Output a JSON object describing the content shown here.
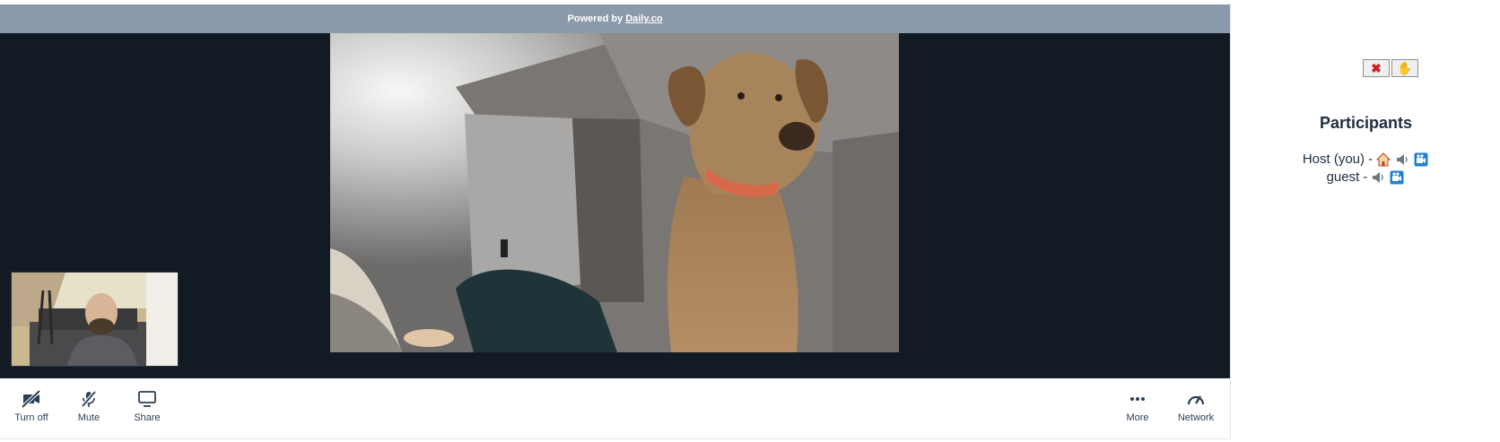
{
  "banner": {
    "powered_by": "Powered by",
    "brand_link": "Daily.co"
  },
  "tray": {
    "left": [
      {
        "label": "Turn off",
        "icon": "camera-off-icon"
      },
      {
        "label": "Mute",
        "icon": "mic-off-icon"
      },
      {
        "label": "Share",
        "icon": "screen-share-icon"
      }
    ],
    "right": [
      {
        "label": "More",
        "icon": "more-dots-icon"
      },
      {
        "label": "Network",
        "icon": "network-gauge-icon"
      }
    ]
  },
  "panel": {
    "controls": [
      {
        "icon": "close-x-icon",
        "glyph": "✖",
        "color": "#d41c1c"
      },
      {
        "icon": "raised-hand-icon",
        "glyph": "✋",
        "color": "#f2b417"
      }
    ],
    "title": "Participants",
    "participants": [
      {
        "name": "Host (you) -",
        "icons": [
          "house-icon",
          "speaker-icon",
          "camera-icon"
        ]
      },
      {
        "name": "guest -",
        "icons": [
          "speaker-icon",
          "camera-icon"
        ]
      }
    ]
  },
  "colors": {
    "banner": "#8a99ab",
    "stage": "#121a24",
    "text": "#2b3f56"
  }
}
